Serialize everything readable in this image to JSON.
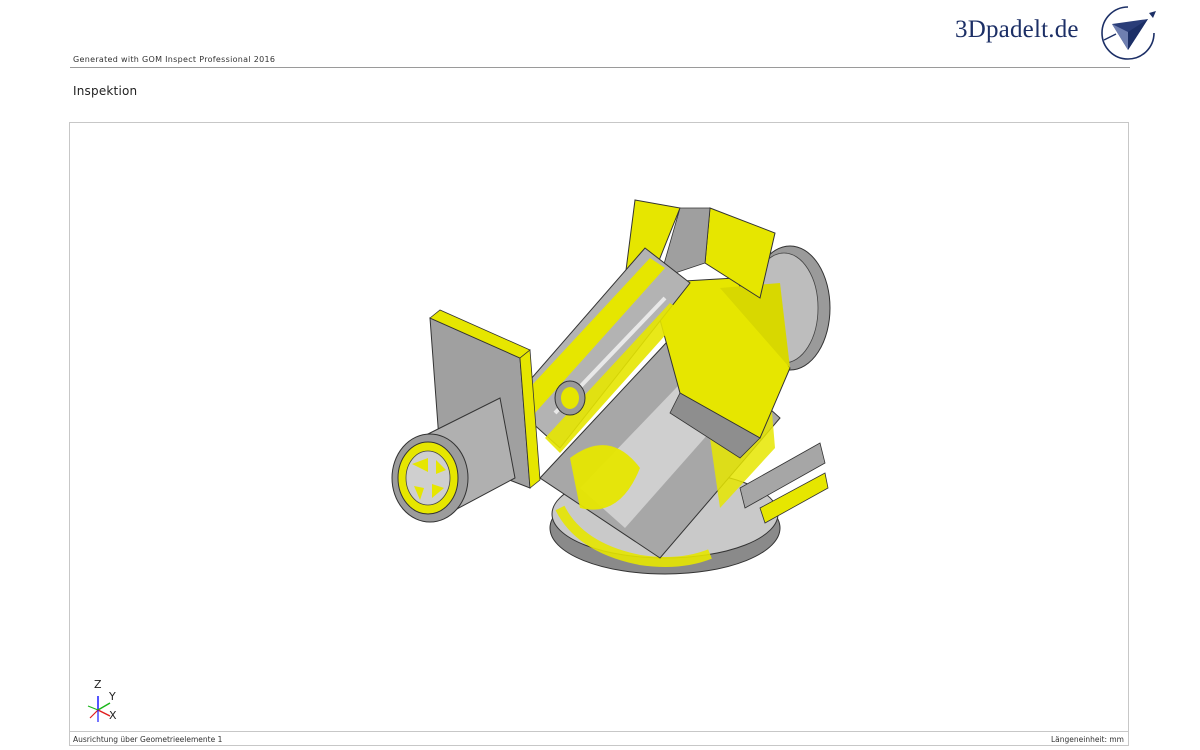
{
  "header": {
    "generated_text": "Generated with GOM Inspect Professional 2016",
    "logo_text": "3Dpadelt.de",
    "logo_icon": "3dpadelt-logo-icon"
  },
  "section": {
    "title": "Inspektion"
  },
  "viewport": {
    "model_icon": "scanned-part-3d-model",
    "highlight_color": "#e6e600",
    "surface_color": "#9a9a9a",
    "axes": {
      "z": "Z",
      "y": "Y",
      "x": "X"
    }
  },
  "footer": {
    "left": "Ausrichtung über Geometrieelemente 1",
    "right": "Längeneinheit: mm"
  }
}
